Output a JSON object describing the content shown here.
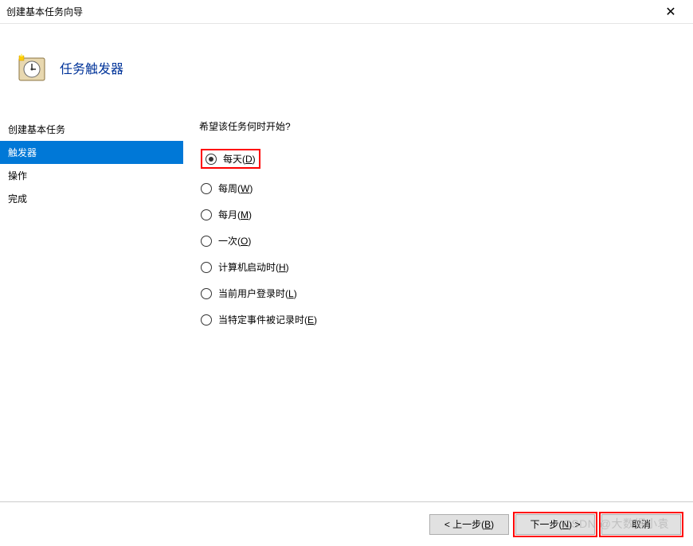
{
  "window": {
    "title": "创建基本任务向导",
    "close_symbol": "✕"
  },
  "header": {
    "title": "任务触发器"
  },
  "sidebar": {
    "items": [
      {
        "label": "创建基本任务",
        "selected": false
      },
      {
        "label": "触发器",
        "selected": true
      },
      {
        "label": "操作",
        "selected": false
      },
      {
        "label": "完成",
        "selected": false
      }
    ]
  },
  "main": {
    "question": "希望该任务何时开始?",
    "options": [
      {
        "label": "每天",
        "mnemonic": "D",
        "checked": true,
        "highlighted": true
      },
      {
        "label": "每周",
        "mnemonic": "W",
        "checked": false,
        "highlighted": false
      },
      {
        "label": "每月",
        "mnemonic": "M",
        "checked": false,
        "highlighted": false
      },
      {
        "label": "一次",
        "mnemonic": "O",
        "checked": false,
        "highlighted": false
      },
      {
        "label": "计算机启动时",
        "mnemonic": "H",
        "checked": false,
        "highlighted": false
      },
      {
        "label": "当前用户登录时",
        "mnemonic": "L",
        "checked": false,
        "highlighted": false
      },
      {
        "label": "当特定事件被记录时",
        "mnemonic": "E",
        "checked": false,
        "highlighted": false
      }
    ]
  },
  "footer": {
    "back": {
      "label": "< 上一步",
      "mnemonic": "B",
      "highlighted": false
    },
    "next": {
      "label": "下一步",
      "mnemonic": "N",
      "suffix": " >",
      "highlighted": true
    },
    "cancel": {
      "label": "取消",
      "highlighted": true
    }
  },
  "watermark": "CSDN @大数据小袁"
}
